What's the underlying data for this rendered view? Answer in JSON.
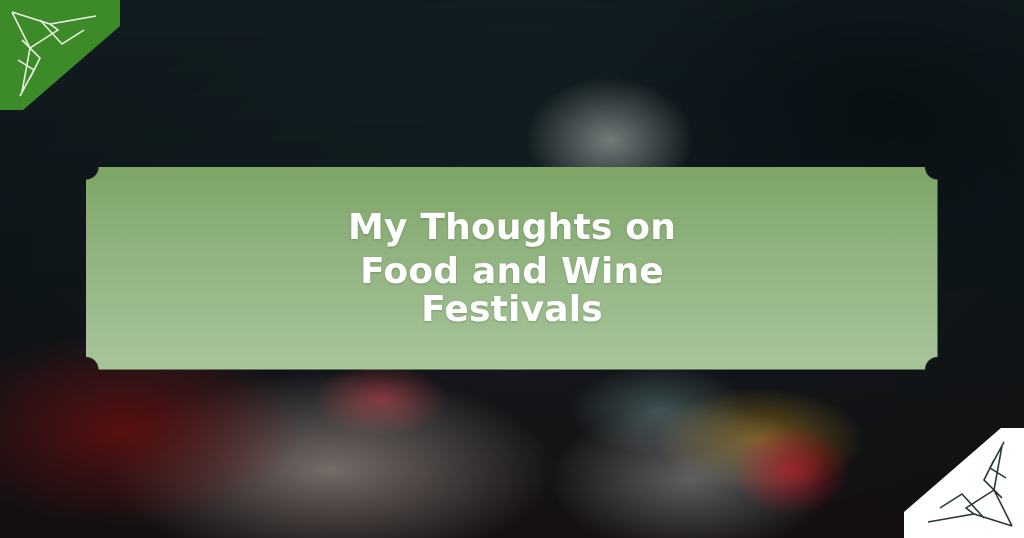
{
  "hero": {
    "title_line1": "My Thoughts on",
    "title_line2": "Food and Wine",
    "title_line3": "Festivals"
  },
  "colors": {
    "banner_top": "#7ea468",
    "banner_bottom": "#a9c59c",
    "ornament_green": "#3f8a2c",
    "ornament_white": "#ffffff",
    "title_text": "#ffffff"
  },
  "icons": {
    "top_left": "leaf-corner-ornament",
    "bottom_right": "leaf-corner-ornament"
  }
}
